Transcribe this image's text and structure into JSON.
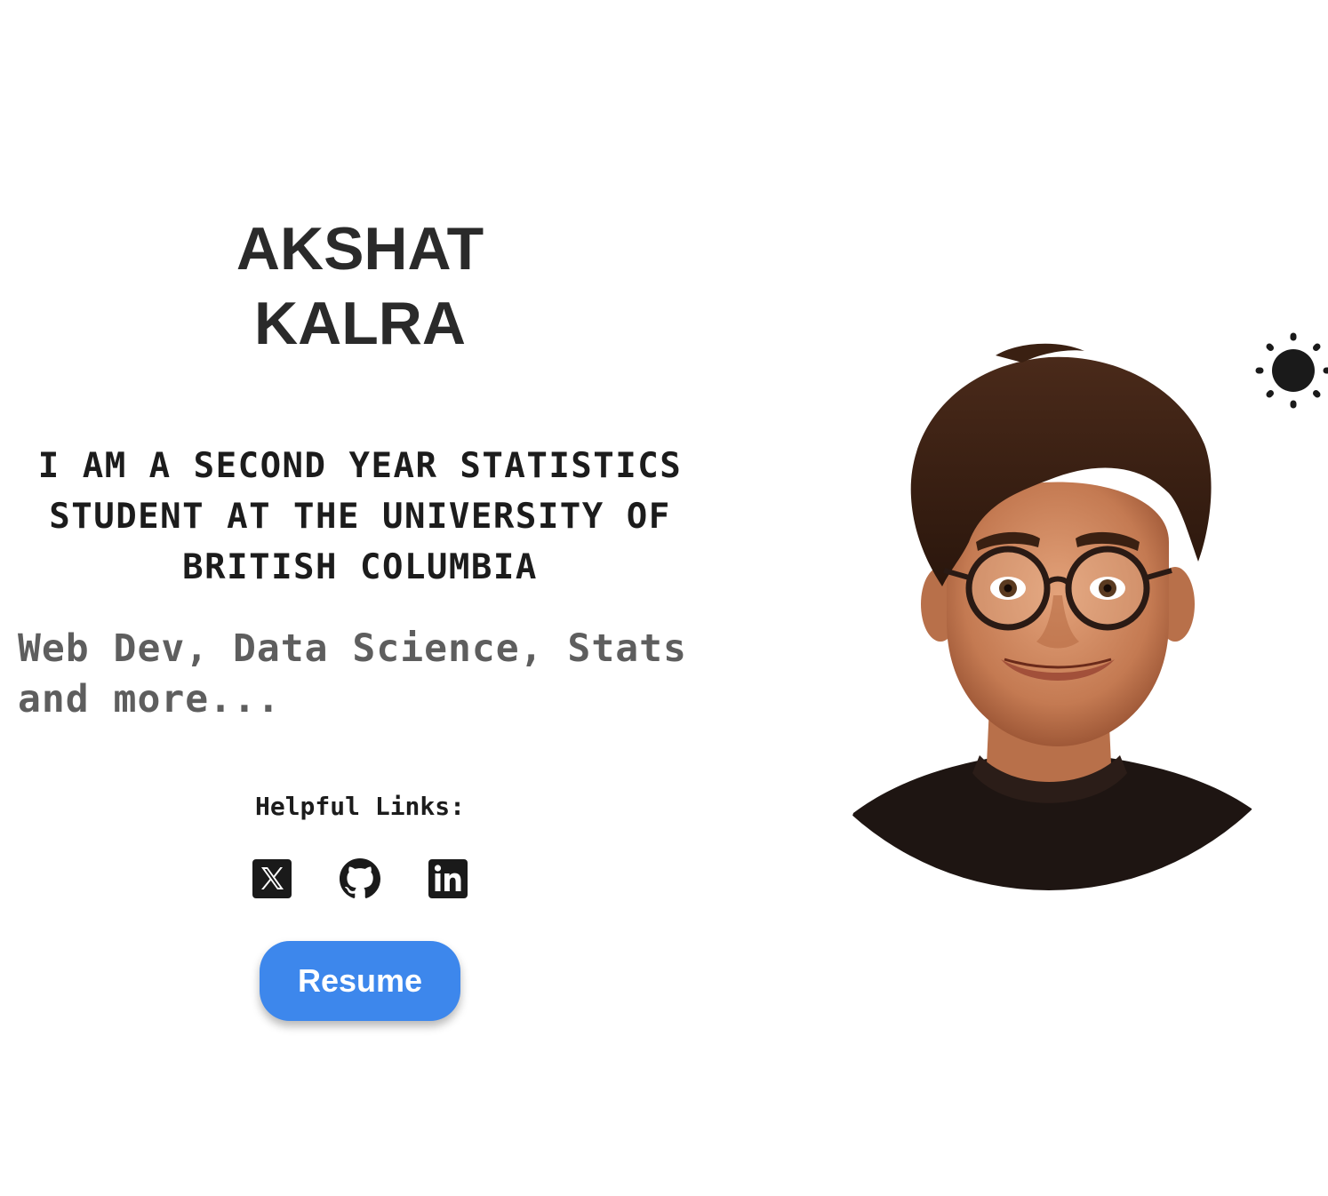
{
  "hero": {
    "name_line1": "AKSHAT",
    "name_line2": "KALRA",
    "tagline_line1": "I AM A SECOND YEAR STATISTICS",
    "tagline_line2": "STUDENT AT THE UNIVERSITY OF",
    "tagline_line3": "BRITISH COLUMBIA",
    "interests_line1": "Web Dev, Data Science, Stats",
    "interests_line2": "and more..."
  },
  "links": {
    "label": "Helpful Links:",
    "items": [
      {
        "name": "x-twitter",
        "icon": "x-logo-icon"
      },
      {
        "name": "github",
        "icon": "github-icon"
      },
      {
        "name": "linkedin",
        "icon": "linkedin-icon"
      }
    ]
  },
  "resume": {
    "label": "Resume",
    "color": "#3d87ec"
  },
  "avatar": {
    "icon": "avatar-illustration"
  },
  "theme_toggle": {
    "icon": "sun-icon"
  }
}
